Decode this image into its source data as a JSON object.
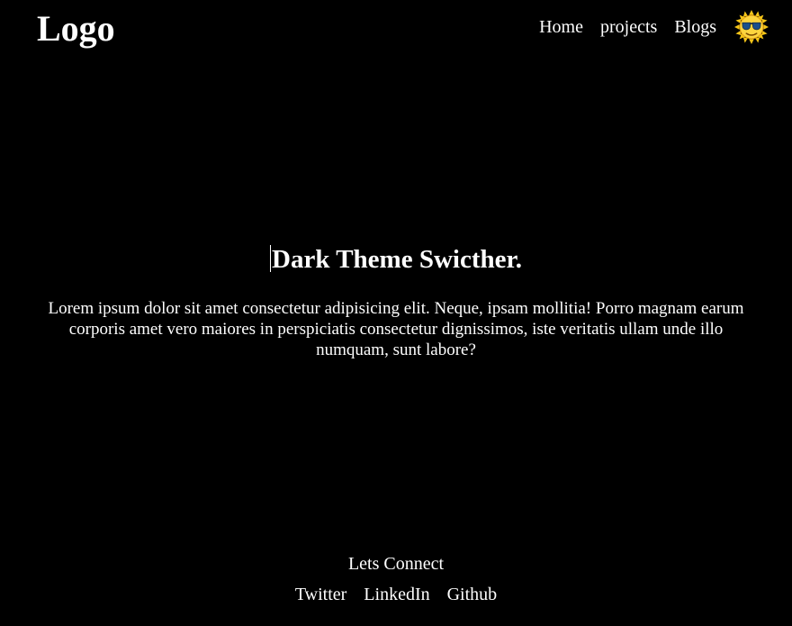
{
  "header": {
    "logo": "Logo",
    "nav": [
      "Home",
      "projects",
      "Blogs"
    ],
    "theme_toggle_icon": "sunglasses-sun-icon"
  },
  "hero": {
    "title": "Dark Theme Swicther.",
    "text": "Lorem ipsum dolor sit amet consectetur adipisicing elit. Neque, ipsam mollitia! Porro magnam earum corporis amet vero maiores in perspiciatis consectetur dignissimos, iste veritatis ullam unde illo numquam, sunt labore?"
  },
  "footer": {
    "title": "Lets Connect",
    "links": [
      "Twitter",
      "LinkedIn",
      "Github"
    ]
  },
  "colors": {
    "background": "#000000",
    "text": "#ffffff",
    "sun": "#f5c518",
    "glasses": "#1b4f8a"
  }
}
